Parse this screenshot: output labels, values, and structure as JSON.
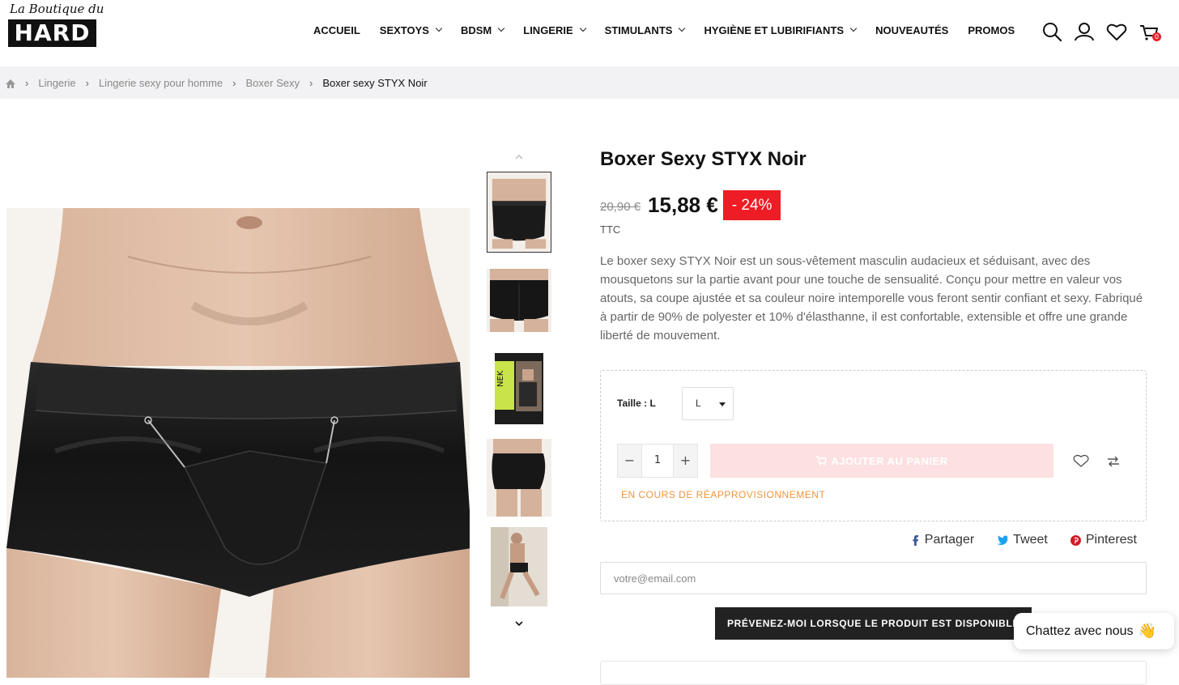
{
  "logo": {
    "script": "La Boutique du",
    "word": "HARD"
  },
  "nav": [
    {
      "label": "ACCUEIL",
      "dropdown": false
    },
    {
      "label": "SEXTOYS",
      "dropdown": true
    },
    {
      "label": "BDSM",
      "dropdown": true
    },
    {
      "label": "LINGERIE",
      "dropdown": true
    },
    {
      "label": "STIMULANTS",
      "dropdown": true
    },
    {
      "label": "HYGIÈNE ET LUBIRIFIANTS",
      "dropdown": true
    },
    {
      "label": "NOUVEAUTÉS",
      "dropdown": false
    },
    {
      "label": "PROMOS",
      "dropdown": false
    }
  ],
  "header_icons": [
    "search-icon",
    "account-icon",
    "wishlist-icon",
    "cart-icon"
  ],
  "cart_count": "0",
  "breadcrumb": [
    "Lingerie",
    "Lingerie sexy pour homme",
    "Boxer Sexy",
    "Boxer sexy STYX Noir"
  ],
  "product": {
    "title": "Boxer Sexy STYX Noir",
    "old_price": "20,90 €",
    "price": "15,88 €",
    "discount": "- 24%",
    "tax_note": "TTC",
    "description": "Le boxer sexy STYX Noir est un sous-vêtement masculin audacieux et séduisant, avec des mousquetons sur la partie avant pour une touche de sensualité. Conçu pour mettre en valeur vos atouts, sa coupe ajustée et sa couleur noire intemporelle vous feront sentir confiant et sexy. Fabriqué à partir de 90% de polyester et 10% d'élasthanne, il est confortable, extensible et offre une grande liberté de mouvement.",
    "size_label": "Taille : L",
    "size_value": "L",
    "quantity": "1",
    "add_to_cart": "AJOUTER AU PANIER",
    "availability": "EN COURS DE RÉAPPROVISIONNEMENT"
  },
  "share": {
    "facebook": "Partager",
    "twitter": "Tweet",
    "pinterest": "Pinterest"
  },
  "notify": {
    "email_placeholder": "votre@email.com",
    "button": "PRÉVENEZ-MOI LORSQUE LE PRODUIT EST DISPONIBLE"
  },
  "chat": {
    "label": "Chattez avec nous",
    "emoji": "👋"
  },
  "colors": {
    "discount_red": "#ee1c24",
    "cart_disabled": "#fde0e1",
    "restock_orange": "#f0953b",
    "notify_dark": "#222222"
  }
}
